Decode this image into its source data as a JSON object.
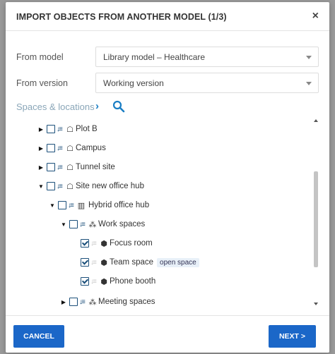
{
  "dialog": {
    "title": "IMPORT OBJECTS FROM ANOTHER MODEL  (1/3)",
    "close": "×"
  },
  "form": {
    "from_model_label": "From model",
    "from_model_value": "Library model – Healthcare",
    "from_version_label": "From version",
    "from_version_value": "Working version",
    "spaces_label": "Spaces & locations",
    "chevron": "›"
  },
  "tree": [
    {
      "label": "Plot B",
      "toggle": "▶",
      "checked": false,
      "sort_dim": false,
      "icon": "☖",
      "tag": ""
    },
    {
      "label": "Campus",
      "toggle": "▶",
      "checked": false,
      "sort_dim": false,
      "icon": "☖",
      "tag": ""
    },
    {
      "label": "Tunnel site",
      "toggle": "▶",
      "checked": false,
      "sort_dim": false,
      "icon": "☖",
      "tag": ""
    },
    {
      "label": "Site new office hub",
      "toggle": "▼",
      "checked": false,
      "sort_dim": false,
      "icon": "☖",
      "tag": ""
    },
    {
      "label": "Hybrid office hub",
      "toggle": "▼",
      "checked": false,
      "sort_dim": false,
      "icon": "▥",
      "tag": ""
    },
    {
      "label": "Work spaces",
      "toggle": "▼",
      "checked": false,
      "sort_dim": false,
      "icon": "⁂",
      "tag": ""
    },
    {
      "label": "Focus room",
      "toggle": "",
      "checked": true,
      "sort_dim": true,
      "icon": "⬢",
      "tag": ""
    },
    {
      "label": "Team space",
      "toggle": "",
      "checked": true,
      "sort_dim": true,
      "icon": "⬢",
      "tag": "open space"
    },
    {
      "label": "Phone booth",
      "toggle": "",
      "checked": true,
      "sort_dim": true,
      "icon": "⬢",
      "tag": ""
    },
    {
      "label": "Meeting spaces",
      "toggle": "▶",
      "checked": false,
      "sort_dim": false,
      "icon": "⁂",
      "tag": ""
    }
  ],
  "footer": {
    "cancel_label": "CANCEL",
    "next_label": "NEXT >"
  },
  "colors": {
    "primary": "#1b67c8",
    "accent": "#1a7ec4",
    "checkbox": "#1b4f7a"
  }
}
